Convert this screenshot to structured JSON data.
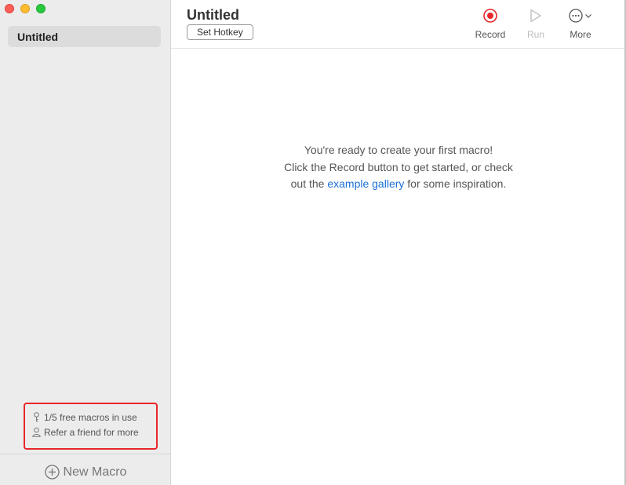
{
  "sidebar": {
    "macros": [
      {
        "label": "Untitled"
      }
    ],
    "usage": {
      "macros_in_use": "1/5 free macros in use",
      "refer": "Refer a friend for more"
    },
    "new_macro_label": "New Macro"
  },
  "header": {
    "title": "Untitled",
    "hotkey_label": "Set Hotkey"
  },
  "toolbar": {
    "record_label": "Record",
    "run_label": "Run",
    "more_label": "More"
  },
  "empty_state": {
    "line1": "You're ready to create your first macro!",
    "line2": "Click the Record button to get started, or check",
    "line3_prefix": "out the ",
    "line3_link": "example gallery",
    "line3_suffix": " for some inspiration."
  },
  "colors": {
    "record_accent": "#e8262b",
    "link": "#1a6fd6",
    "highlight_border": "#e8262b"
  }
}
